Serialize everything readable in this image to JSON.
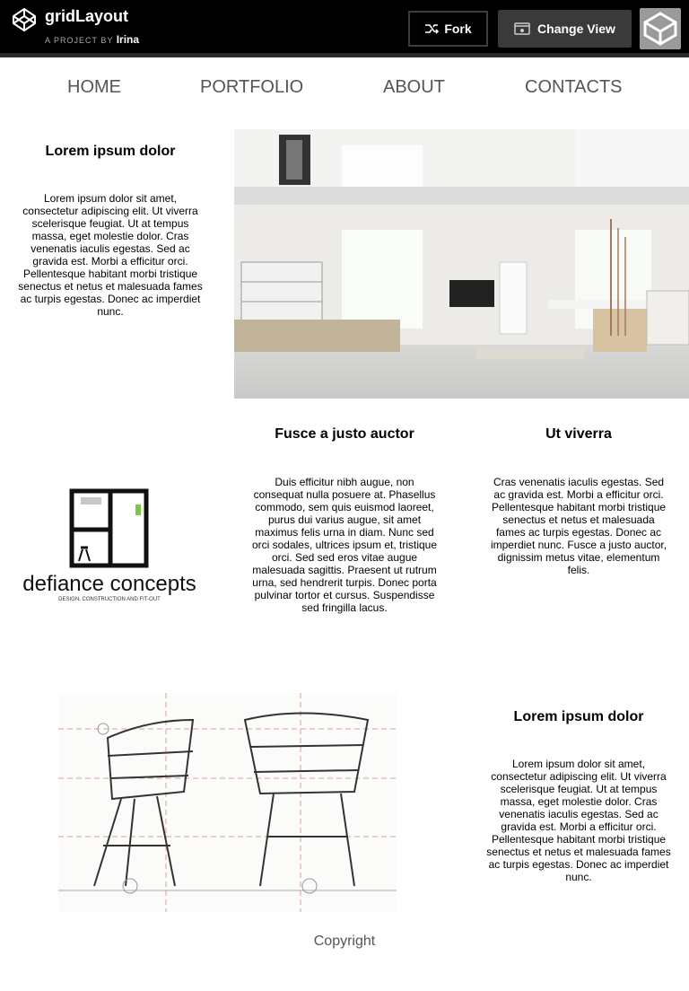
{
  "header": {
    "title": "gridLayout",
    "byline_prefix": "A PROJECT BY",
    "author": "Irina",
    "fork_label": "Fork",
    "change_view_label": "Change View"
  },
  "nav": {
    "items": [
      "HOME",
      "PORTFOLIO",
      "ABOUT",
      "CONTACTS"
    ]
  },
  "sections": {
    "intro": {
      "heading": "Lorem ipsum dolor",
      "text": "Lorem ipsum dolor sit amet, consectetur adipiscing elit. Ut viverra scelerisque feugiat. Ut at tempus massa, eget molestie dolor. Cras venenatis iaculis egestas. Sed ac gravida est. Morbi a efficitur orci. Pellentesque habitant morbi tristique senectus et netus et malesuada fames ac turpis egestas. Donec ac imperdiet nunc."
    },
    "fusce": {
      "heading": "Fusce a justo auctor",
      "text": "Duis efficitur nibh augue, non consequat nulla posuere at. Phasellus commodo, sem quis euismod laoreet, purus dui varius augue, sit amet maximus felis urna in diam. Nunc sed orci sodales, ultrices ipsum et, tristique orci. Sed sed eros vitae augue malesuada sagittis. Praesent ut rutrum urna, sed hendrerit turpis. Donec porta pulvinar tortor et cursus. Suspendisse sed fringilla lacus."
    },
    "viverra": {
      "heading": "Ut viverra",
      "text": "Cras venenatis iaculis egestas. Sed ac gravida est. Morbi a efficitur orci. Pellentesque habitant morbi tristique senectus et netus et malesuada fames ac turpis egestas. Donec ac imperdiet nunc. Fusce a justo auctor, dignissim metus vitae, elementum felis."
    },
    "outro": {
      "heading": "Lorem ipsum dolor",
      "text": "Lorem ipsum dolor sit amet, consectetur adipiscing elit. Ut viverra scelerisque feugiat. Ut at tempus massa, eget molestie dolor. Cras venenatis iaculis egestas. Sed ac gravida est. Morbi a efficitur orci. Pellentesque habitant morbi tristique senectus et netus et malesuada fames ac turpis egestas. Donec ac imperdiet nunc."
    }
  },
  "logo": {
    "brand": "defiance concepts",
    "tagline": "DESIGN, CONSTRUCTION AND FIT-OUT"
  },
  "footer": {
    "copyright": "Copyright"
  },
  "icons": {
    "codepen": "codepen-logo-icon",
    "fork": "fork-icon",
    "view": "change-view-icon"
  },
  "colors": {
    "topbar_bg": "#000000",
    "button_dark": "#3a3a3a",
    "nav_text": "#555555",
    "logo_accent": "#7ac943"
  }
}
